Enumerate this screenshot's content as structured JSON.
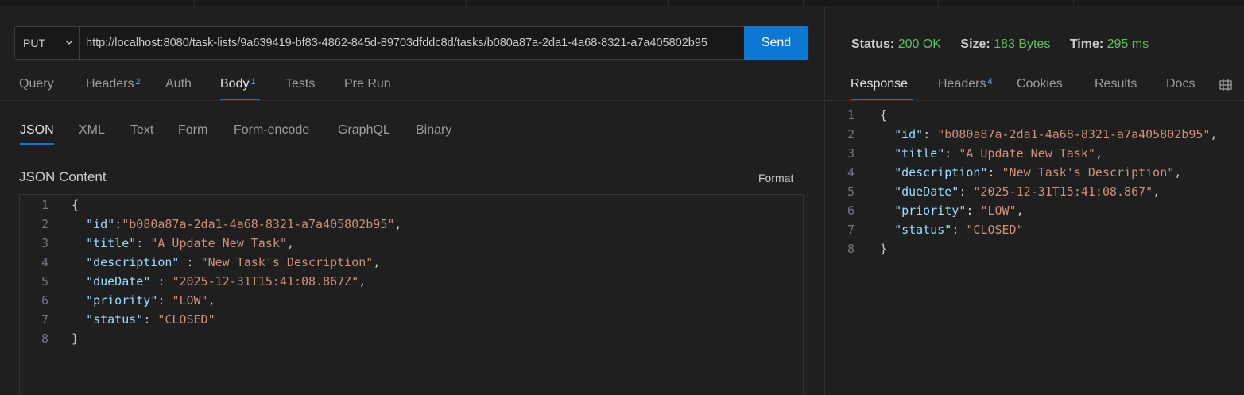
{
  "request": {
    "method": "PUT",
    "url": "http://localhost:8080/task-lists/9a639419-bf83-4862-845d-89703dfddc8d/tasks/b080a87a-2da1-4a68-8321-a7a405802b95",
    "send_label": "Send"
  },
  "request_tabs": [
    {
      "label": "Query",
      "badge": ""
    },
    {
      "label": "Headers",
      "badge": "2"
    },
    {
      "label": "Auth",
      "badge": ""
    },
    {
      "label": "Body",
      "badge": "1"
    },
    {
      "label": "Tests",
      "badge": ""
    },
    {
      "label": "Pre Run",
      "badge": ""
    }
  ],
  "body_tabs": [
    "JSON",
    "XML",
    "Text",
    "Form",
    "Form-encode",
    "GraphQL",
    "Binary"
  ],
  "content_label": "JSON Content",
  "format_label": "Format",
  "request_body": [
    {
      "n": "1",
      "parts": [
        [
          "p",
          "{"
        ]
      ]
    },
    {
      "n": "2",
      "parts": [
        [
          "p",
          "  "
        ],
        [
          "k",
          "\"id\""
        ],
        [
          "p",
          ":"
        ],
        [
          "s",
          "\"b080a87a-2da1-4a68-8321-a7a405802b95\""
        ],
        [
          "p",
          ","
        ]
      ]
    },
    {
      "n": "3",
      "parts": [
        [
          "p",
          "  "
        ],
        [
          "k",
          "\"title\""
        ],
        [
          "p",
          ": "
        ],
        [
          "s",
          "\"A Update New Task\""
        ],
        [
          "p",
          ","
        ]
      ]
    },
    {
      "n": "4",
      "parts": [
        [
          "p",
          "  "
        ],
        [
          "k",
          "\"description\""
        ],
        [
          "p",
          " : "
        ],
        [
          "s",
          "\"New Task's Description\""
        ],
        [
          "p",
          ","
        ]
      ]
    },
    {
      "n": "5",
      "parts": [
        [
          "p",
          "  "
        ],
        [
          "k",
          "\"dueDate\""
        ],
        [
          "p",
          " : "
        ],
        [
          "s",
          "\"2025-12-31T15:41:08.867Z\""
        ],
        [
          "p",
          ","
        ]
      ]
    },
    {
      "n": "6",
      "parts": [
        [
          "p",
          "  "
        ],
        [
          "k",
          "\"priority\""
        ],
        [
          "p",
          ": "
        ],
        [
          "s",
          "\"LOW\""
        ],
        [
          "p",
          ","
        ]
      ]
    },
    {
      "n": "7",
      "parts": [
        [
          "p",
          "  "
        ],
        [
          "k",
          "\"status\""
        ],
        [
          "p",
          ": "
        ],
        [
          "s",
          "\"CLOSED\""
        ]
      ]
    },
    {
      "n": "8",
      "parts": [
        [
          "p",
          "}"
        ]
      ]
    }
  ],
  "response_status": {
    "status_label": "Status:",
    "status_value": "200 OK",
    "size_label": "Size:",
    "size_value": "183 Bytes",
    "time_label": "Time:",
    "time_value": "295 ms",
    "value_color": "#5cc25c"
  },
  "response_tabs": [
    {
      "label": "Response",
      "badge": ""
    },
    {
      "label": "Headers",
      "badge": "4"
    },
    {
      "label": "Cookies",
      "badge": ""
    },
    {
      "label": "Results",
      "badge": ""
    },
    {
      "label": "Docs",
      "badge": ""
    }
  ],
  "response_body": [
    {
      "n": "1",
      "parts": [
        [
          "p",
          "{"
        ]
      ]
    },
    {
      "n": "2",
      "parts": [
        [
          "p",
          "  "
        ],
        [
          "k",
          "\"id\""
        ],
        [
          "p",
          ": "
        ],
        [
          "s",
          "\"b080a87a-2da1-4a68-8321-a7a405802b95\""
        ],
        [
          "p",
          ","
        ]
      ]
    },
    {
      "n": "3",
      "parts": [
        [
          "p",
          "  "
        ],
        [
          "k",
          "\"title\""
        ],
        [
          "p",
          ": "
        ],
        [
          "s",
          "\"A Update New Task\""
        ],
        [
          "p",
          ","
        ]
      ]
    },
    {
      "n": "4",
      "parts": [
        [
          "p",
          "  "
        ],
        [
          "k",
          "\"description\""
        ],
        [
          "p",
          ": "
        ],
        [
          "s",
          "\"New Task's Description\""
        ],
        [
          "p",
          ","
        ]
      ]
    },
    {
      "n": "5",
      "parts": [
        [
          "p",
          "  "
        ],
        [
          "k",
          "\"dueDate\""
        ],
        [
          "p",
          ": "
        ],
        [
          "s",
          "\"2025-12-31T15:41:08.867\""
        ],
        [
          "p",
          ","
        ]
      ]
    },
    {
      "n": "6",
      "parts": [
        [
          "p",
          "  "
        ],
        [
          "k",
          "\"priority\""
        ],
        [
          "p",
          ": "
        ],
        [
          "s",
          "\"LOW\""
        ],
        [
          "p",
          ","
        ]
      ]
    },
    {
      "n": "7",
      "parts": [
        [
          "p",
          "  "
        ],
        [
          "k",
          "\"status\""
        ],
        [
          "p",
          ": "
        ],
        [
          "s",
          "\"CLOSED\""
        ]
      ]
    },
    {
      "n": "8",
      "parts": [
        [
          "p",
          "}"
        ]
      ]
    }
  ],
  "icons": {
    "method_dropdown": "chevron-down-icon",
    "layout_toggle": "split-layout-icon"
  },
  "colors": {
    "accent": "#0e78d5",
    "json_key": "#9cdcfe",
    "json_string": "#ce9178",
    "badge": "#4daafc"
  }
}
